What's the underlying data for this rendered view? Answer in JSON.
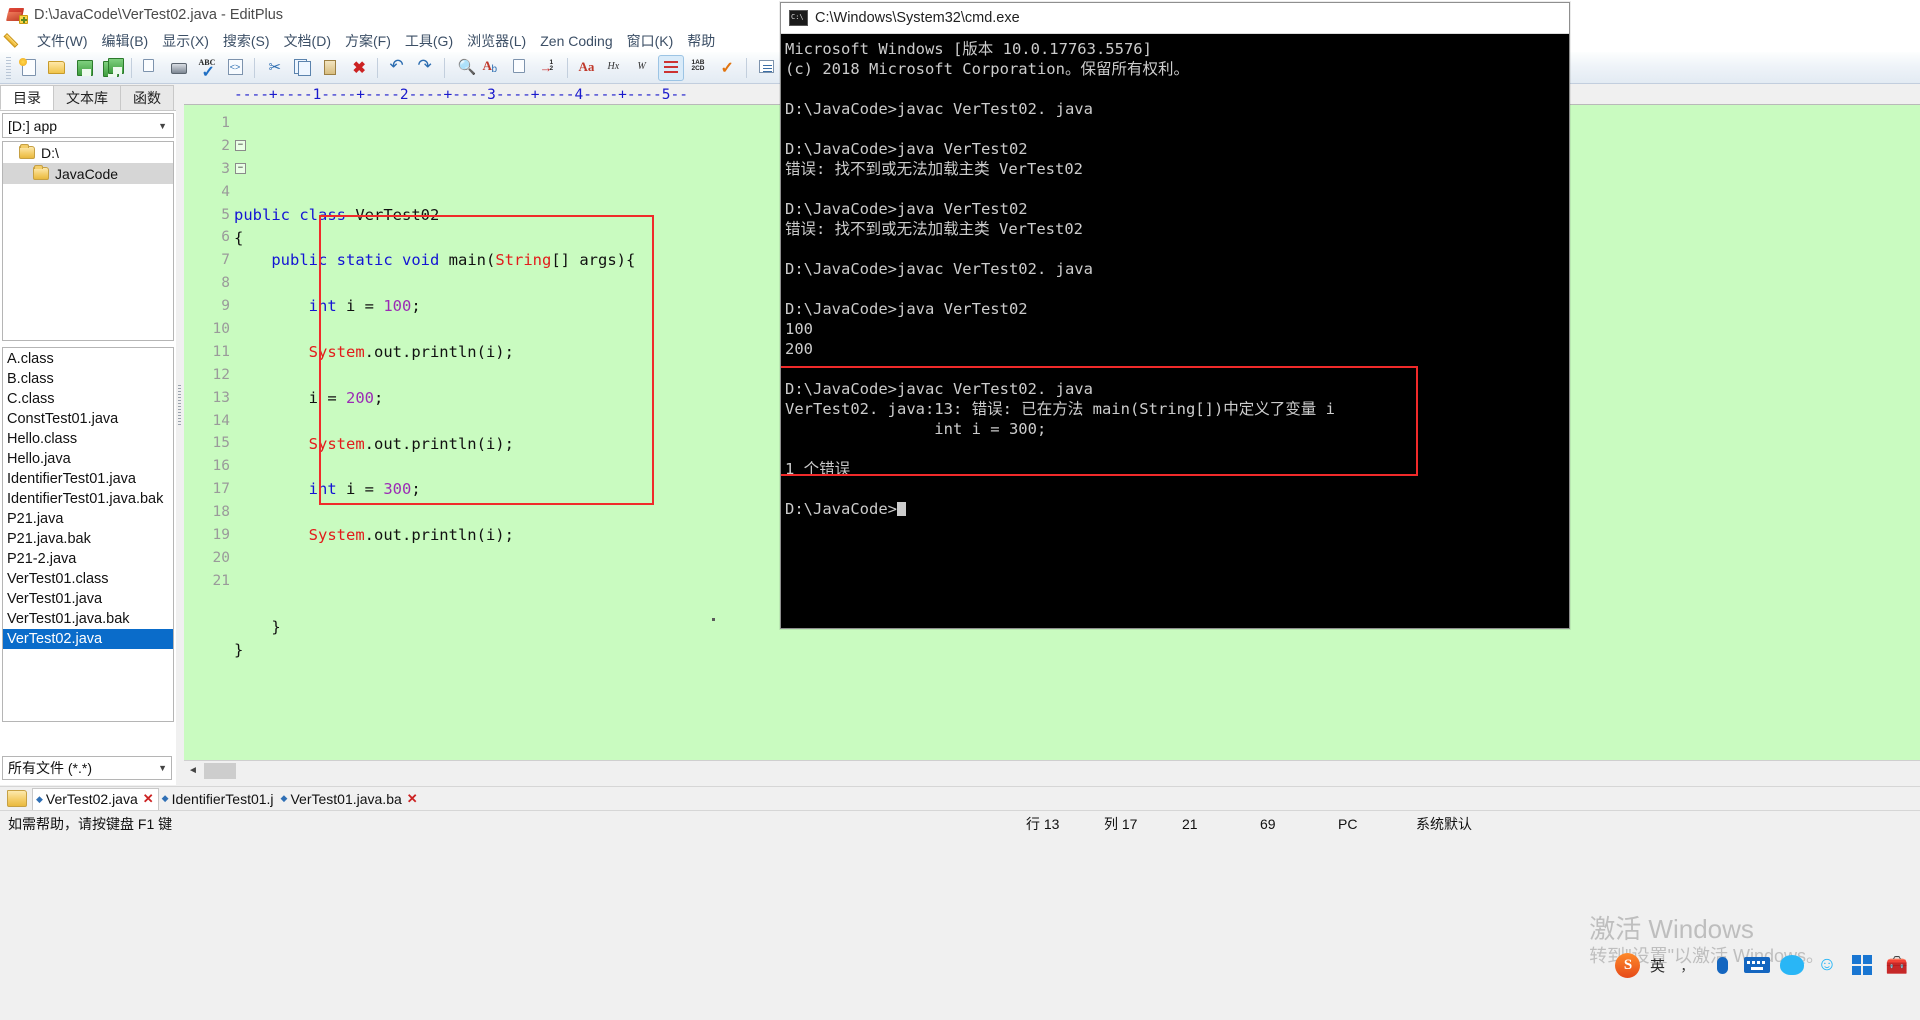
{
  "editor_window": {
    "title": "D:\\JavaCode\\VerTest02.java - EditPlus",
    "menu": [
      "文件(W)",
      "编辑(B)",
      "显示(X)",
      "搜索(S)",
      "文档(D)",
      "方案(F)",
      "工具(G)",
      "浏览器(L)",
      "Zen Coding",
      "窗口(K)",
      "帮助"
    ],
    "left_panel": {
      "tabs": [
        "目录",
        "文本库",
        "函数"
      ],
      "selected_tab": "目录",
      "drive": "[D:] app",
      "tree": [
        {
          "label": "D:\\",
          "level": 1,
          "selected": false
        },
        {
          "label": "JavaCode",
          "level": 2,
          "selected": true
        }
      ],
      "files": [
        {
          "name": "A.class",
          "selected": false
        },
        {
          "name": "B.class",
          "selected": false
        },
        {
          "name": "C.class",
          "selected": false
        },
        {
          "name": "ConstTest01.java",
          "selected": false
        },
        {
          "name": "Hello.class",
          "selected": false
        },
        {
          "name": "Hello.java",
          "selected": false
        },
        {
          "name": "IdentifierTest01.java",
          "selected": false
        },
        {
          "name": "IdentifierTest01.java.bak",
          "selected": false
        },
        {
          "name": "P21.java",
          "selected": false
        },
        {
          "name": "P21.java.bak",
          "selected": false
        },
        {
          "name": "P21-2.java",
          "selected": false
        },
        {
          "name": "VerTest01.class",
          "selected": false
        },
        {
          "name": "VerTest01.java",
          "selected": false
        },
        {
          "name": "VerTest01.java.bak",
          "selected": false
        },
        {
          "name": "VerTest02.java",
          "selected": true
        }
      ],
      "filter": "所有文件 (*.*)"
    },
    "ruler": "----+----1----+----2----+----3----+----4----+----5--",
    "code_lines": [
      {
        "n": 1,
        "fold": "",
        "tokens": [
          {
            "t": "public",
            "c": "kw"
          },
          {
            "t": " ",
            "c": "plain"
          },
          {
            "t": "class",
            "c": "kw"
          },
          {
            "t": " VerTest02",
            "c": "plain"
          }
        ]
      },
      {
        "n": 2,
        "fold": "−",
        "tokens": [
          {
            "t": "{",
            "c": "plain"
          }
        ]
      },
      {
        "n": 3,
        "fold": "−",
        "tokens": [
          {
            "t": "    ",
            "c": "plain"
          },
          {
            "t": "public",
            "c": "kw"
          },
          {
            "t": " ",
            "c": "plain"
          },
          {
            "t": "static",
            "c": "kw"
          },
          {
            "t": " ",
            "c": "plain"
          },
          {
            "t": "void",
            "c": "kw"
          },
          {
            "t": " main(",
            "c": "plain"
          },
          {
            "t": "String",
            "c": "type-red"
          },
          {
            "t": "[] args){",
            "c": "plain"
          }
        ]
      },
      {
        "n": 4,
        "fold": "",
        "tokens": []
      },
      {
        "n": 5,
        "fold": "",
        "tokens": [
          {
            "t": "        ",
            "c": "plain"
          },
          {
            "t": "int",
            "c": "kw"
          },
          {
            "t": " i = ",
            "c": "plain"
          },
          {
            "t": "100",
            "c": "num"
          },
          {
            "t": ";",
            "c": "plain"
          }
        ]
      },
      {
        "n": 6,
        "fold": "",
        "tokens": []
      },
      {
        "n": 7,
        "fold": "",
        "tokens": [
          {
            "t": "        ",
            "c": "plain"
          },
          {
            "t": "System",
            "c": "type-red"
          },
          {
            "t": ".out.println(i);",
            "c": "plain"
          }
        ]
      },
      {
        "n": 8,
        "fold": "",
        "tokens": []
      },
      {
        "n": 9,
        "fold": "",
        "tokens": [
          {
            "t": "        i = ",
            "c": "plain"
          },
          {
            "t": "200",
            "c": "num"
          },
          {
            "t": ";",
            "c": "plain"
          }
        ]
      },
      {
        "n": 10,
        "fold": "",
        "tokens": []
      },
      {
        "n": 11,
        "fold": "",
        "tokens": [
          {
            "t": "        ",
            "c": "plain"
          },
          {
            "t": "System",
            "c": "type-red"
          },
          {
            "t": ".out.println(i);",
            "c": "plain"
          }
        ]
      },
      {
        "n": 12,
        "fold": "",
        "tokens": []
      },
      {
        "n": 13,
        "fold": "",
        "tokens": [
          {
            "t": "        ",
            "c": "plain"
          },
          {
            "t": "int",
            "c": "kw"
          },
          {
            "t": " i = ",
            "c": "plain"
          },
          {
            "t": "300",
            "c": "num"
          },
          {
            "t": ";",
            "c": "plain"
          }
        ]
      },
      {
        "n": 14,
        "fold": "",
        "tokens": []
      },
      {
        "n": 15,
        "fold": "",
        "tokens": [
          {
            "t": "        ",
            "c": "plain"
          },
          {
            "t": "System",
            "c": "type-red"
          },
          {
            "t": ".out.println(i);",
            "c": "plain"
          }
        ]
      },
      {
        "n": 16,
        "fold": "",
        "tokens": []
      },
      {
        "n": 17,
        "fold": "",
        "tokens": []
      },
      {
        "n": 18,
        "fold": "",
        "tokens": []
      },
      {
        "n": 19,
        "fold": "",
        "tokens": [
          {
            "t": "    }",
            "c": "plain"
          }
        ]
      },
      {
        "n": 20,
        "fold": "",
        "tokens": [
          {
            "t": "}",
            "c": "plain"
          }
        ]
      },
      {
        "n": 21,
        "fold": "",
        "tokens": []
      }
    ],
    "document_tabs": [
      {
        "label": "VerTest02.java",
        "selected": true
      },
      {
        "label": "IdentifierTest01.j",
        "selected": false
      },
      {
        "label": "VerTest01.java.ba",
        "selected": false
      }
    ],
    "statusbar": {
      "help": "如需帮助，请按键盘 F1 键",
      "line": "行 13",
      "column": "列 17",
      "offset": "21",
      "total": "69",
      "mode": "PC",
      "encoding": "系统默认"
    }
  },
  "cmd_window": {
    "title": "C:\\Windows\\System32\\cmd.exe",
    "lines": [
      "Microsoft Windows [版本 10.0.17763.5576]",
      "(c) 2018 Microsoft Corporation。保留所有权利。",
      "",
      "D:\\JavaCode>javac VerTest02. java",
      "",
      "D:\\JavaCode>java VerTest02",
      "错误: 找不到或无法加载主类 VerTest02",
      "",
      "D:\\JavaCode>java VerTest02",
      "错误: 找不到或无法加载主类 VerTest02",
      "",
      "D:\\JavaCode>javac VerTest02. java",
      "",
      "D:\\JavaCode>java VerTest02",
      "100",
      "200",
      "",
      "D:\\JavaCode>javac VerTest02. java",
      "VerTest02. java:13: 错误: 已在方法 main(String[])中定义了变量 i",
      "                int i = 300;",
      "",
      "1 个错误",
      "",
      "D:\\JavaCode>"
    ]
  },
  "desktop": {
    "watermark_line1": "激活 Windows",
    "watermark_line2": "转到\"设置\"以激活 Windows。",
    "tray": {
      "ime_label": "英",
      "sogou_label": "S"
    }
  },
  "annotations": {
    "code_highlight_color": "#f02a2a",
    "console_highlight_color": "#f02a2a"
  }
}
